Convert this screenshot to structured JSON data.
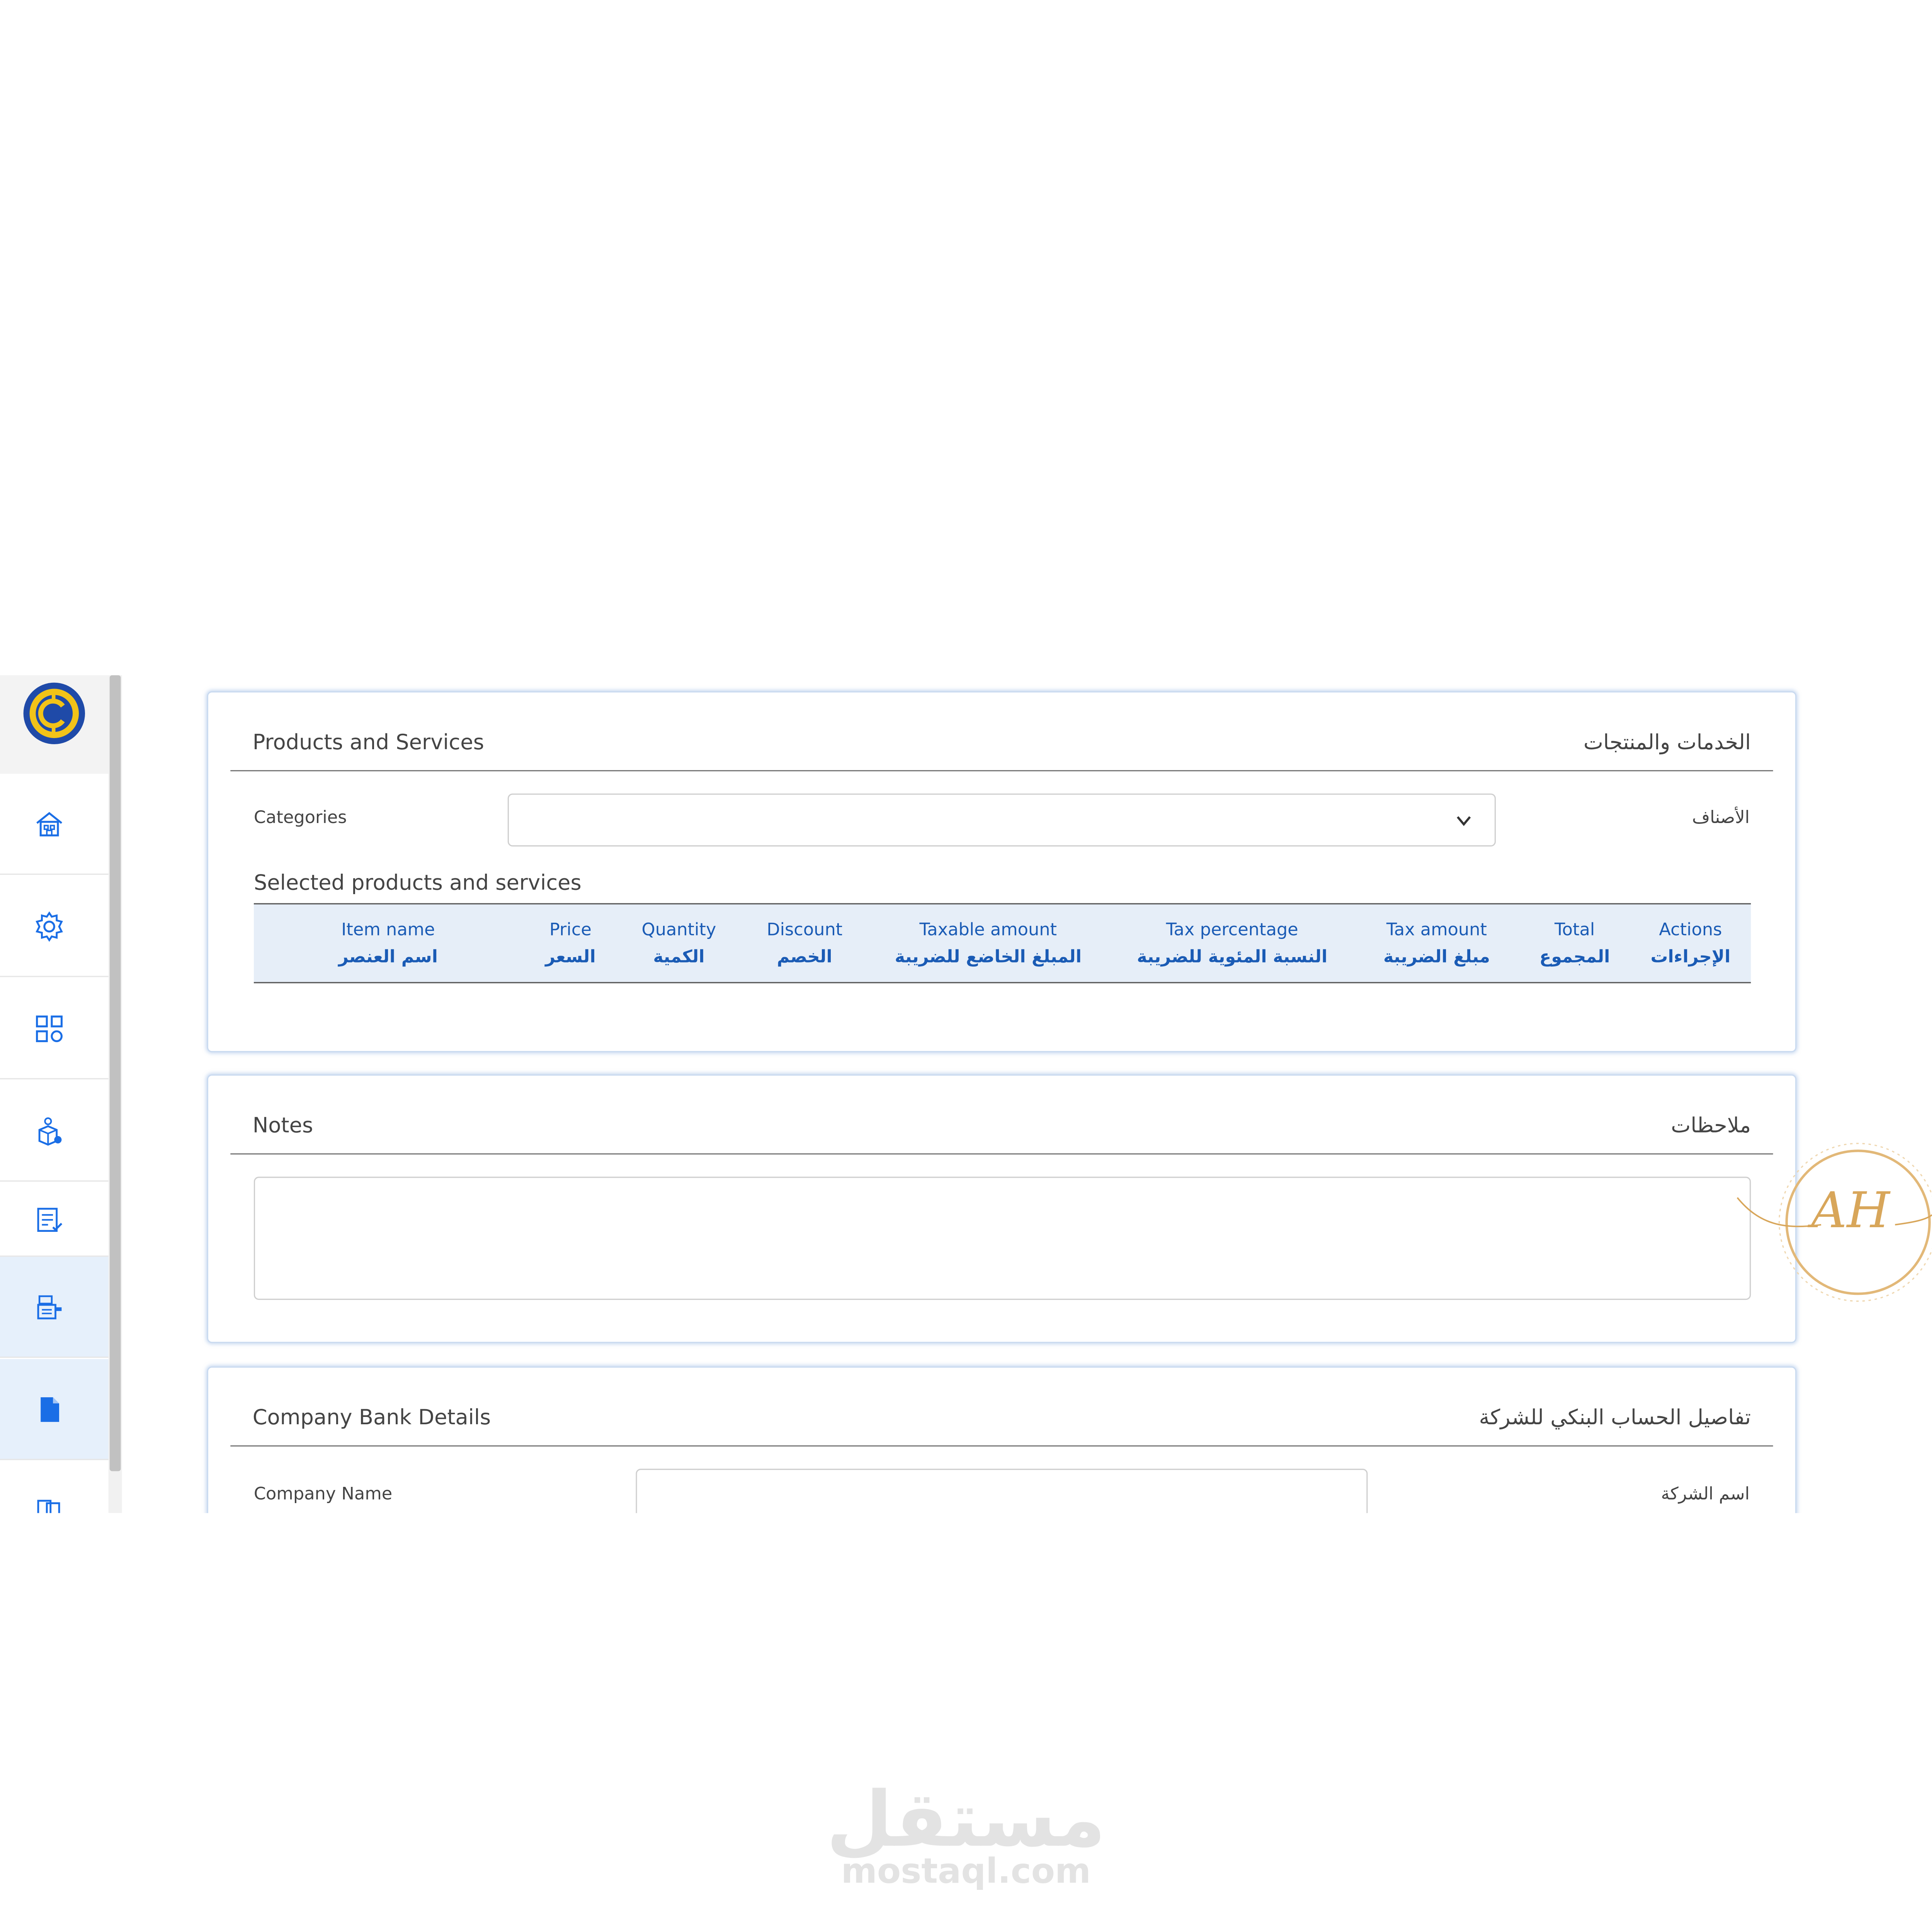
{
  "sidebar": {
    "items": [
      {
        "icon": "home-icon"
      },
      {
        "icon": "gear-icon"
      },
      {
        "icon": "grid-icon"
      },
      {
        "icon": "box-settings-icon"
      },
      {
        "icon": "invoice-check-icon"
      },
      {
        "icon": "cash-register-icon"
      },
      {
        "icon": "document-icon"
      },
      {
        "icon": "document-pages-icon"
      }
    ],
    "active_color": "#1a6ee6",
    "highlight_bg": "#e6f0fb"
  },
  "products": {
    "title_en": "Products and Services",
    "title_ar": "الخدمات والمنتجات",
    "categories_label_en": "Categories",
    "categories_label_ar": "الأصناف",
    "categories_value": "",
    "selected_title": "Selected products and services",
    "columns": [
      {
        "en": "Item name",
        "ar": "اسم العنصر"
      },
      {
        "en": "Price",
        "ar": "السعر"
      },
      {
        "en": "Quantity",
        "ar": "الكمية"
      },
      {
        "en": "Discount",
        "ar": "الخصم"
      },
      {
        "en": "Taxable amount",
        "ar": "المبلغ الخاضع للضريبة"
      },
      {
        "en": "Tax percentage",
        "ar": "النسبة المئوية للضريبة"
      },
      {
        "en": "Tax amount",
        "ar": "مبلغ الضريبة"
      },
      {
        "en": "Total",
        "ar": "المجموع"
      },
      {
        "en": "Actions",
        "ar": "الإجراءات"
      }
    ],
    "header_color": "#1a5bb5",
    "header_bg": "#e6eef8"
  },
  "notes": {
    "title_en": "Notes",
    "title_ar": "ملاحظات",
    "value": ""
  },
  "bank": {
    "title_en": "Company Bank Details",
    "title_ar": "تفاصيل الحساب البنكي للشركة",
    "company_name_label_en": "Company Name",
    "company_name_label_ar": "اسم الشركة",
    "company_name_value": ""
  },
  "watermark": {
    "stamp_text": "AH",
    "site_ar": "مستقل",
    "site_en": "mostaql.com"
  }
}
